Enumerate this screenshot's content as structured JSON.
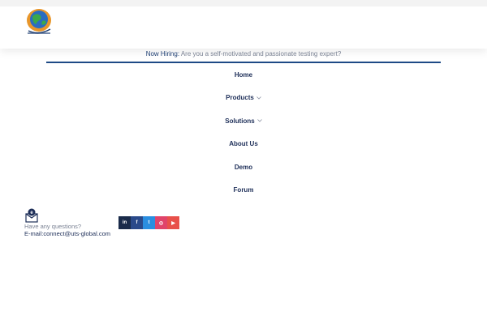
{
  "header": {
    "logo_alt": "UTS Global logo"
  },
  "hiring": {
    "label": "Now Hiring:",
    "text": "Are you a self-motivated and passionate testing expert?"
  },
  "menu": {
    "items": [
      {
        "label": "Home"
      },
      {
        "label": "Products"
      },
      {
        "label": "Solutions"
      },
      {
        "label": "About Us"
      },
      {
        "label": "Demo"
      },
      {
        "label": "Forum"
      }
    ]
  },
  "contact": {
    "question": "Have any questions?",
    "email": "E-mail:connect@uts-global.com"
  },
  "social": [
    {
      "name": "linkedin-icon",
      "glyph": "in",
      "color": "#1a2b4a"
    },
    {
      "name": "facebook-icon",
      "glyph": "f",
      "color": "#2a4a8a"
    },
    {
      "name": "twitter-icon",
      "glyph": "t",
      "color": "#2a8ee0"
    },
    {
      "name": "instagram-icon",
      "glyph": "◎",
      "color": "#e0446a"
    },
    {
      "name": "youtube-icon",
      "glyph": "▶",
      "color": "#e8504a"
    }
  ],
  "colors": {
    "brand_navy": "#1d2e58",
    "accent_blue": "#1e4a86",
    "muted_text": "#7a8293"
  }
}
